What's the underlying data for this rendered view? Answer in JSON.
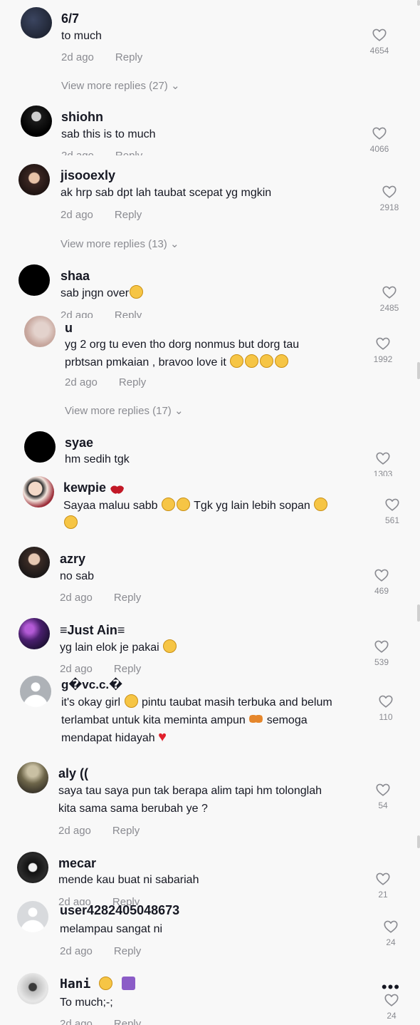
{
  "labels": {
    "reply": "Reply",
    "more_options": "•••"
  },
  "comments": [
    {
      "username": "6/7",
      "text": "to much",
      "date": "2d ago",
      "likes": "4654",
      "replies": "View more replies (27)"
    },
    {
      "username": "shiohn",
      "text": "sab this is to much",
      "date": "2d ago",
      "likes": "4066"
    },
    {
      "username": "jisooexly",
      "text": "ak hrp sab dpt lah taubat scepat yg mgkin",
      "date": "2d ago",
      "likes": "2918",
      "replies": "View more replies (13)"
    },
    {
      "username": "shaa",
      "text": "sab jngn over",
      "date": "2d ago",
      "likes": "2485"
    },
    {
      "username": "u",
      "text_line1": "yg 2 org tu even tho dorg nonmus but dorg tau",
      "text_line2": "prbtsan pmkaian , bravoo love it",
      "date": "2d ago",
      "likes": "1992",
      "replies": "View more replies (17)"
    },
    {
      "username": "syae",
      "text": "hm sedih tgk",
      "likes": "1303"
    },
    {
      "username": "kewpie",
      "text_a": "Sayaa maluu sabb",
      "text_b": "Tgk yg lain lebih sopan",
      "likes": "561"
    },
    {
      "username": "azry",
      "text": "no sab",
      "date": "2d ago",
      "likes": "469"
    },
    {
      "username": "≡Just Ain≡",
      "text": "yg lain elok je pakai",
      "date": "2d ago",
      "likes": "539"
    },
    {
      "username": "g�vc.c.�",
      "text_a": "it's okay girl",
      "text_b": "pintu taubat masih terbuka and belum",
      "text_c": "terlambat untuk kita meminta ampun",
      "text_d": "semoga",
      "text_e": "mendapat hidayah",
      "likes": "110"
    },
    {
      "username": "aly ((",
      "text_line1": "saya tau saya pun tak berapa alim tapi hm tolonglah",
      "text_line2": "kita sama sama berubah ye ?",
      "date": "2d ago",
      "likes": "54"
    },
    {
      "username": "mecar",
      "text": "mende kau buat ni sabariah",
      "date": "2d ago",
      "likes": "21"
    },
    {
      "username": "user4282405048673",
      "text": "melampau sangat ni",
      "date": "2d ago",
      "likes": "24"
    },
    {
      "username": "Hani",
      "text": "To much;-;",
      "date": "2d ago",
      "likes": "24"
    }
  ],
  "colors": {
    "background": "#f8f8f8",
    "text": "#161823",
    "muted": "#8a8b91"
  }
}
